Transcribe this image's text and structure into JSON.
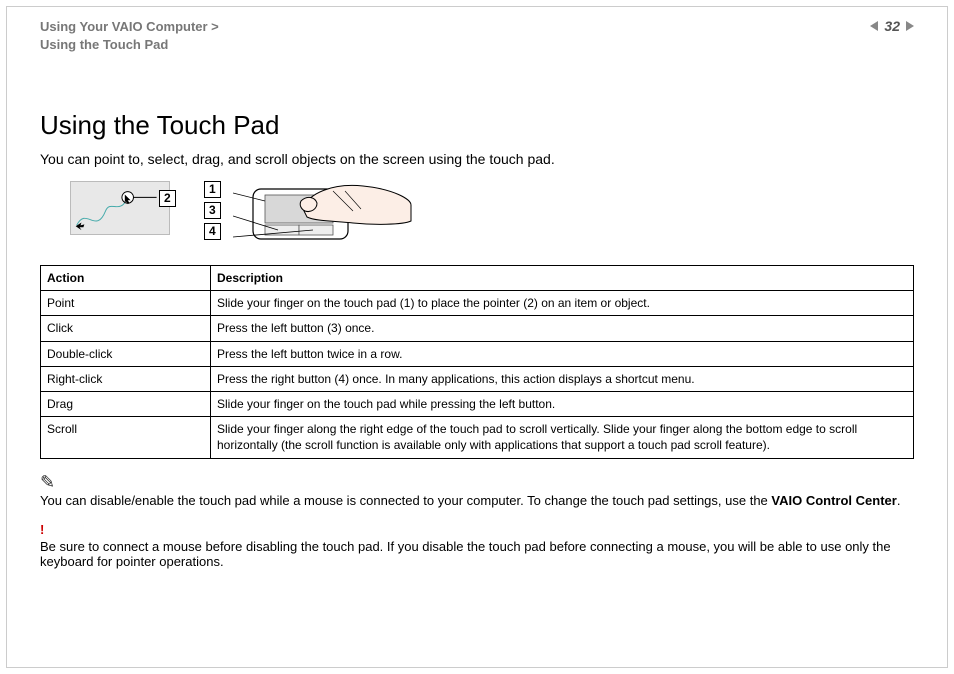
{
  "header": {
    "breadcrumb_line1": "Using Your VAIO Computer >",
    "breadcrumb_line2": "Using the Touch Pad",
    "page_number": "32"
  },
  "title": "Using the Touch Pad",
  "intro": "You can point to, select, drag, and scroll objects on the screen using the touch pad.",
  "callouts": {
    "n1": "1",
    "n2": "2",
    "n3": "3",
    "n4": "4"
  },
  "table": {
    "head": {
      "col1": "Action",
      "col2": "Description"
    },
    "rows": [
      {
        "action": "Point",
        "desc": "Slide your finger on the touch pad (1) to place the pointer (2) on an item or object."
      },
      {
        "action": "Click",
        "desc": "Press the left button (3) once."
      },
      {
        "action": "Double-click",
        "desc": "Press the left button twice in a row."
      },
      {
        "action": "Right-click",
        "desc": "Press the right button (4) once. In many applications, this action displays a shortcut menu."
      },
      {
        "action": "Drag",
        "desc": "Slide your finger on the touch pad while pressing the left button."
      },
      {
        "action": "Scroll",
        "desc": "Slide your finger along the right edge of the touch pad to scroll vertically. Slide your finger along the bottom edge to scroll horizontally (the scroll function is available only with applications that support a touch pad scroll feature)."
      }
    ]
  },
  "note1": {
    "text_a": "You can disable/enable the touch pad while a mouse is connected to your computer. To change the touch pad settings, use the ",
    "bold": "VAIO Control Center",
    "text_b": "."
  },
  "note2": {
    "text": "Be sure to connect a mouse before disabling the touch pad. If you disable the touch pad before connecting a mouse, you will be able to use only the keyboard for pointer operations."
  }
}
